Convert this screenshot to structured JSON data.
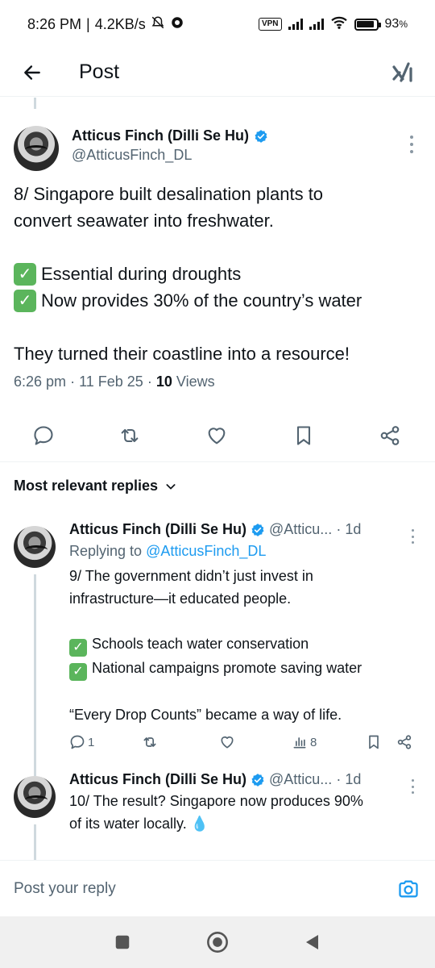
{
  "status_bar": {
    "time": "8:26 PM",
    "separator": "|",
    "speed": "4.2KB/s",
    "vpn_label": "VPN",
    "battery": "93",
    "battery_unit": "%"
  },
  "header": {
    "title": "Post",
    "back_icon": "arrow-left-icon",
    "grok_icon": "grok-icon"
  },
  "main_tweet": {
    "display_name": "Atticus Finch (Dilli Se Hu)",
    "handle": "@AtticusFinch_DL",
    "line1": "8/ Singapore built desalination plants to",
    "line2": "convert seawater into freshwater.",
    "check1": "Essential during droughts",
    "check2": "Now provides 30% of the country’s water",
    "closing": "They turned their coastline into a resource!",
    "time": "6:26 pm",
    "date": "11 Feb 25",
    "views_count": "10",
    "views_label": "Views",
    "dot": "·"
  },
  "sort": {
    "label": "Most relevant replies"
  },
  "replies": [
    {
      "display_name": "Atticus Finch (Dilli Se Hu)",
      "handle": "@Atticu...",
      "time": "1d",
      "dot": "·",
      "replying_prefix": "Replying to",
      "replying_to": "@AtticusFinch_DL",
      "line1": "9/ The government didn’t just invest in",
      "line2": "infrastructure—it educated people.",
      "check1": "Schools teach water conservation",
      "check2": "National campaigns promote saving water",
      "closing": "“Every Drop Counts” became a way of life.",
      "reply_count": "1",
      "views": "8"
    },
    {
      "display_name": "Atticus Finch (Dilli Se Hu)",
      "handle": "@Atticu...",
      "time": "1d",
      "dot": "·",
      "line1": "10/ The result? Singapore now produces 90%",
      "line2": "of its water locally. 💧"
    }
  ],
  "composer": {
    "placeholder": "Post your reply"
  },
  "colors": {
    "accent": "#1d9bf0",
    "secondary_text": "#536471",
    "check_green": "#5bb55c"
  }
}
